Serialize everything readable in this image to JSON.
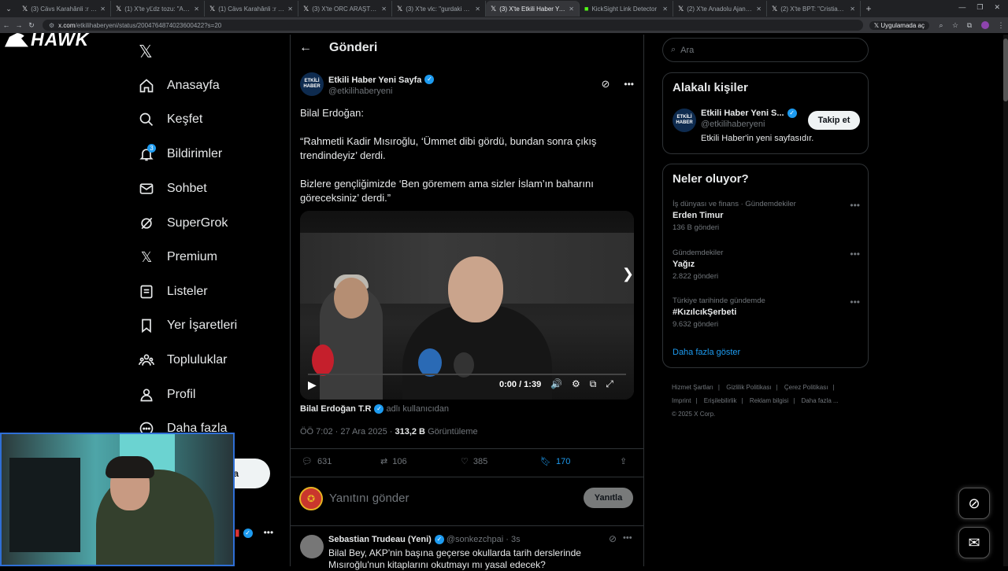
{
  "browser": {
    "tabs": [
      {
        "title": "(3) Cävs Karahânli :r (@karahar...",
        "active": false
      },
      {
        "title": "(1) X'te yĽdz tozu: \"Asla ev...",
        "active": false
      },
      {
        "title": "(1) Cävs Karahânli :r (@karahar...",
        "active": false
      },
      {
        "title": "(3) X'te ORC ARAŞTIRMA: \"Şîîl...",
        "active": false
      },
      {
        "title": "(3) X'te vlc: \"gurdaki SSD (1tb d...",
        "active": false
      },
      {
        "title": "(3) X'te Etkili Haber Yeni Sayfa:",
        "active": true
      },
      {
        "title": "KickSight Link Detector",
        "active": false
      },
      {
        "title": "(2) X'te Anadolu Ajansı: \"*Kuzu...",
        "active": false
      },
      {
        "title": "(2) X'te BPT: \"Cristiano Ronaldo...",
        "active": false
      }
    ],
    "url_host": "x.com",
    "url_path": "/etkilihaberyeni/status/2004764874023600422?s=20",
    "open_in_app": "Uygulamada aç"
  },
  "overlay_logo": "HAWK",
  "sidebar": {
    "items": [
      {
        "label": "Anasayfa",
        "icon": "home-icon"
      },
      {
        "label": "Keşfet",
        "icon": "search-icon"
      },
      {
        "label": "Bildirimler",
        "icon": "bell-icon"
      },
      {
        "label": "Sohbet",
        "icon": "mail-icon"
      },
      {
        "label": "SuperGrok",
        "icon": "grok-icon"
      },
      {
        "label": "Premium",
        "icon": "x-icon"
      },
      {
        "label": "Listeler",
        "icon": "list-icon"
      },
      {
        "label": "Yer İşaretleri",
        "icon": "bookmark-icon"
      },
      {
        "label": "Topluluklar",
        "icon": "people-icon"
      },
      {
        "label": "Profil",
        "icon": "person-icon"
      },
      {
        "label": "Daha fazla",
        "icon": "more-circle-icon"
      }
    ],
    "notification_count": "3",
    "post_button": "a"
  },
  "main": {
    "header_title": "Gönderi",
    "post": {
      "display_name": "Etkili Haber Yeni Sayfa",
      "handle": "@etkilihaberyeni",
      "avatar_text": "ETKİLİ HABER",
      "body": "Bilal Erdoğan:\n\n“Rahmetli Kadir Mısıroğlu, ‘Ümmet dibi gördü, bundan sonra çıkış trendindeyiz’ derdi.\n\nBizlere gençliğimizde ‘Ben göremem ama sizler İslam’ın baharını göreceksiniz’ derdi.”",
      "video": {
        "time": "0:00 / 1:39",
        "progress": 0
      },
      "attribution_name": "Bilal Erdoğan T.R",
      "attribution_suffix": "adlı kullanıcıdan",
      "timestamp": "ÖÖ 7:02 · 27 Ara 2025 ·",
      "views": "313,2 B",
      "views_label": "Görüntüleme",
      "replies": "631",
      "reposts": "106",
      "likes": "385",
      "bookmarks": "170"
    },
    "reply_placeholder": "Yanıtını gönder",
    "reply_button": "Yanıtla",
    "thread_reply": {
      "display_name": "Sebastian Trudeau (Yeni)",
      "handle": "@sonkezchpai",
      "age": "· 3s",
      "text": "Bilal Bey, AKP'nin başına geçerse okullarda tarih derslerinde Mısıroğlu'nun kitaplarını okutmayı mı yasal edecek?"
    }
  },
  "right": {
    "search_placeholder": "Ara",
    "related": {
      "title": "Alakalı kişiler",
      "name": "Etkili Haber Yeni S...",
      "handle": "@etkilihaberyeni",
      "bio": "Etkili Haber'in yeni sayfasıdır.",
      "follow_label": "Takip et"
    },
    "trends": {
      "title": "Neler oluyor?",
      "items": [
        {
          "category": "İş dünyası ve finans · Gündemdekiler",
          "name": "Erden Timur",
          "count": "136 B gönderi"
        },
        {
          "category": "Gündemdekiler",
          "name": "Yağız",
          "count": "2.822 gönderi"
        },
        {
          "category": "Türkiye tarihinde gündemde",
          "name": "#KızılcıkŞerbeti",
          "count": "9.632 gönderi"
        }
      ],
      "show_more": "Daha fazla göster"
    },
    "footer": {
      "links": [
        "Hizmet Şartları",
        "Gizlilik Politikası",
        "Çerez Politikası",
        "Imprint",
        "Erişilebilirlik",
        "Reklam bilgisi",
        "Daha fazla ..."
      ],
      "copyright": "© 2025 X Corp."
    }
  },
  "colors": {
    "accent": "#1d9bf0",
    "background": "#000000",
    "border": "#2f3336",
    "muted": "#71767b"
  }
}
